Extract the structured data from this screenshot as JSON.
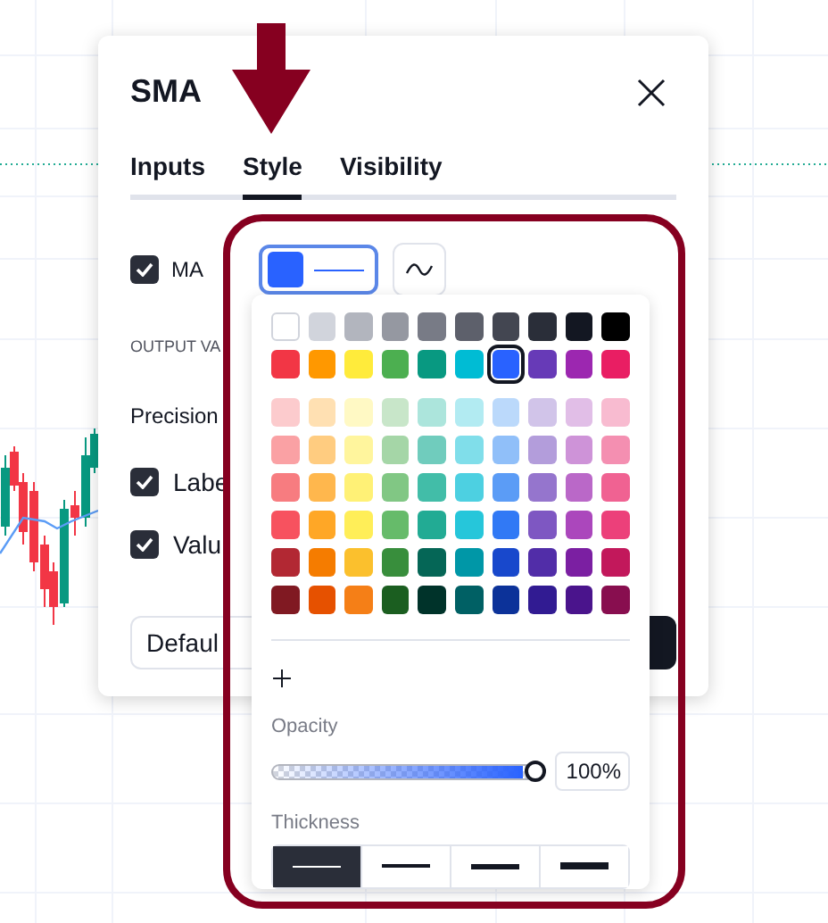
{
  "dialog": {
    "title": "SMA",
    "tabs": [
      {
        "label": "Inputs",
        "selected": false
      },
      {
        "label": "Style",
        "selected": true
      },
      {
        "label": "Visibility",
        "selected": false
      }
    ],
    "plot": {
      "label": "MA",
      "checked": true,
      "color": "#2962ff"
    },
    "section_heading": "OUTPUT VA",
    "precision_label": "Precision",
    "options": [
      {
        "label": "Labe",
        "checked": true
      },
      {
        "label": "Valu",
        "checked": true
      }
    ],
    "defaults": "Defaul"
  },
  "color_popup": {
    "swatch_rows": [
      [
        {
          "color": "#ffffff",
          "selected": false
        },
        {
          "color": "#d1d4dc",
          "selected": false
        },
        {
          "color": "#b2b5be",
          "selected": false
        },
        {
          "color": "#9598a1",
          "selected": false
        },
        {
          "color": "#787b86",
          "selected": false
        },
        {
          "color": "#5d606b",
          "selected": false
        },
        {
          "color": "#434651",
          "selected": false
        },
        {
          "color": "#2a2e39",
          "selected": false
        },
        {
          "color": "#131722",
          "selected": false
        },
        {
          "color": "#000000",
          "selected": false
        }
      ],
      [
        {
          "color": "#f23645",
          "selected": false
        },
        {
          "color": "#ff9800",
          "selected": false
        },
        {
          "color": "#ffeb3b",
          "selected": false
        },
        {
          "color": "#4caf50",
          "selected": false
        },
        {
          "color": "#089981",
          "selected": false
        },
        {
          "color": "#00bcd4",
          "selected": false
        },
        {
          "color": "#2962ff",
          "selected": true
        },
        {
          "color": "#673ab7",
          "selected": false
        },
        {
          "color": "#9c27b0",
          "selected": false
        },
        {
          "color": "#e91e63",
          "selected": false
        }
      ],
      [
        {
          "color": "#fccbcd",
          "selected": false
        },
        {
          "color": "#ffe0b2",
          "selected": false
        },
        {
          "color": "#fff9c4",
          "selected": false
        },
        {
          "color": "#c8e6c9",
          "selected": false
        },
        {
          "color": "#ace5dc",
          "selected": false
        },
        {
          "color": "#b2ebf2",
          "selected": false
        },
        {
          "color": "#bbd9fb",
          "selected": false
        },
        {
          "color": "#d1c4e9",
          "selected": false
        },
        {
          "color": "#e1bee7",
          "selected": false
        },
        {
          "color": "#f8bbd0",
          "selected": false
        }
      ],
      [
        {
          "color": "#faa1a4",
          "selected": false
        },
        {
          "color": "#ffcc80",
          "selected": false
        },
        {
          "color": "#fff59d",
          "selected": false
        },
        {
          "color": "#a5d6a7",
          "selected": false
        },
        {
          "color": "#70ccbd",
          "selected": false
        },
        {
          "color": "#80deea",
          "selected": false
        },
        {
          "color": "#90bff9",
          "selected": false
        },
        {
          "color": "#b39ddb",
          "selected": false
        },
        {
          "color": "#ce93d8",
          "selected": false
        },
        {
          "color": "#f48fb1",
          "selected": false
        }
      ],
      [
        {
          "color": "#f77c80",
          "selected": false
        },
        {
          "color": "#ffb74d",
          "selected": false
        },
        {
          "color": "#fff176",
          "selected": false
        },
        {
          "color": "#81c784",
          "selected": false
        },
        {
          "color": "#42bda8",
          "selected": false
        },
        {
          "color": "#4dd0e1",
          "selected": false
        },
        {
          "color": "#5b9cf6",
          "selected": false
        },
        {
          "color": "#9575cd",
          "selected": false
        },
        {
          "color": "#ba68c8",
          "selected": false
        },
        {
          "color": "#f06292",
          "selected": false
        }
      ],
      [
        {
          "color": "#f7525f",
          "selected": false
        },
        {
          "color": "#ffa726",
          "selected": false
        },
        {
          "color": "#ffee58",
          "selected": false
        },
        {
          "color": "#66bb6a",
          "selected": false
        },
        {
          "color": "#22ab94",
          "selected": false
        },
        {
          "color": "#26c6da",
          "selected": false
        },
        {
          "color": "#3179f5",
          "selected": false
        },
        {
          "color": "#7e57c2",
          "selected": false
        },
        {
          "color": "#ab47bc",
          "selected": false
        },
        {
          "color": "#ec407a",
          "selected": false
        }
      ],
      [
        {
          "color": "#b22833",
          "selected": false
        },
        {
          "color": "#f57c00",
          "selected": false
        },
        {
          "color": "#fbc02d",
          "selected": false
        },
        {
          "color": "#388e3c",
          "selected": false
        },
        {
          "color": "#056656",
          "selected": false
        },
        {
          "color": "#0097a7",
          "selected": false
        },
        {
          "color": "#1848cc",
          "selected": false
        },
        {
          "color": "#512da8",
          "selected": false
        },
        {
          "color": "#7b1fa2",
          "selected": false
        },
        {
          "color": "#c2185b",
          "selected": false
        }
      ],
      [
        {
          "color": "#801922",
          "selected": false
        },
        {
          "color": "#e65100",
          "selected": false
        },
        {
          "color": "#f57f17",
          "selected": false
        },
        {
          "color": "#1b5e20",
          "selected": false
        },
        {
          "color": "#00332a",
          "selected": false
        },
        {
          "color": "#006064",
          "selected": false
        },
        {
          "color": "#0c3299",
          "selected": false
        },
        {
          "color": "#311b92",
          "selected": false
        },
        {
          "color": "#4a148c",
          "selected": false
        },
        {
          "color": "#880e4f",
          "selected": false
        }
      ]
    ],
    "opacity_label": "Opacity",
    "opacity": {
      "level": 1,
      "reading": "100%"
    },
    "thickness_label": "Thickness",
    "thickness": [
      {
        "selected": true
      },
      {
        "selected": false
      },
      {
        "selected": false
      },
      {
        "selected": false
      }
    ]
  }
}
